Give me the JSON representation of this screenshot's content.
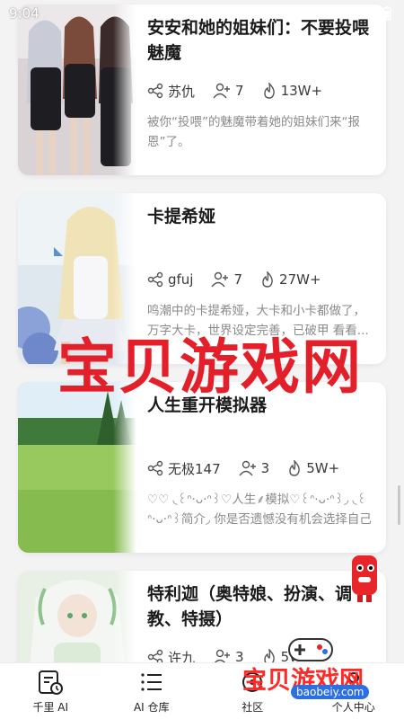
{
  "status_bar": {
    "time": "9:04"
  },
  "cards": [
    {
      "title": "安安和她的姐妹们：不要投喂魅魔",
      "author": "苏仇",
      "followers": "7",
      "heat": "13W+",
      "description": "被你“投喂”的魅魔带着她的姐妹们来“报恩”了。"
    },
    {
      "title": "卡提希娅",
      "author": "gfuj",
      "followers": "7",
      "heat": "27W+",
      "description": "鸣潮中的卡提希娅，大卡和小卡都做了，万字大卡，世界设定完善，已破甲 看看..."
    },
    {
      "title": "人生重开模拟器",
      "author": "无极147",
      "followers": "3",
      "heat": "5W+",
      "description": "♡♡ ◟꒰ᐢ·ᴗ·ᐢ꒱♡人生⸙模拟♡꒰ᐢ·ᴗ·ᐢ꒱◞ ◟꒰ᐢ·ᴗ·ᐢ꒱简介◞ 你是否遗憾没有机会选择自己的..."
    },
    {
      "title": "特利迦（奥特娘、扮演、调教、特摄）",
      "author": "许九",
      "followers": "3",
      "heat": "5W+",
      "description": ""
    }
  ],
  "nav": [
    {
      "label": "千里 AI",
      "icon": "calendar-clock-icon"
    },
    {
      "label": "AI 仓库",
      "icon": "list-icon"
    },
    {
      "label": "社区",
      "icon": "community-icon"
    },
    {
      "label": "个人中心",
      "icon": "user-icon"
    }
  ],
  "watermark": {
    "text": "宝贝游戏网",
    "small_text": "宝贝游戏网",
    "url": "baobeiy.com"
  },
  "colors": {
    "watermark": "#e3202a",
    "accent": "#2b6fe0"
  }
}
